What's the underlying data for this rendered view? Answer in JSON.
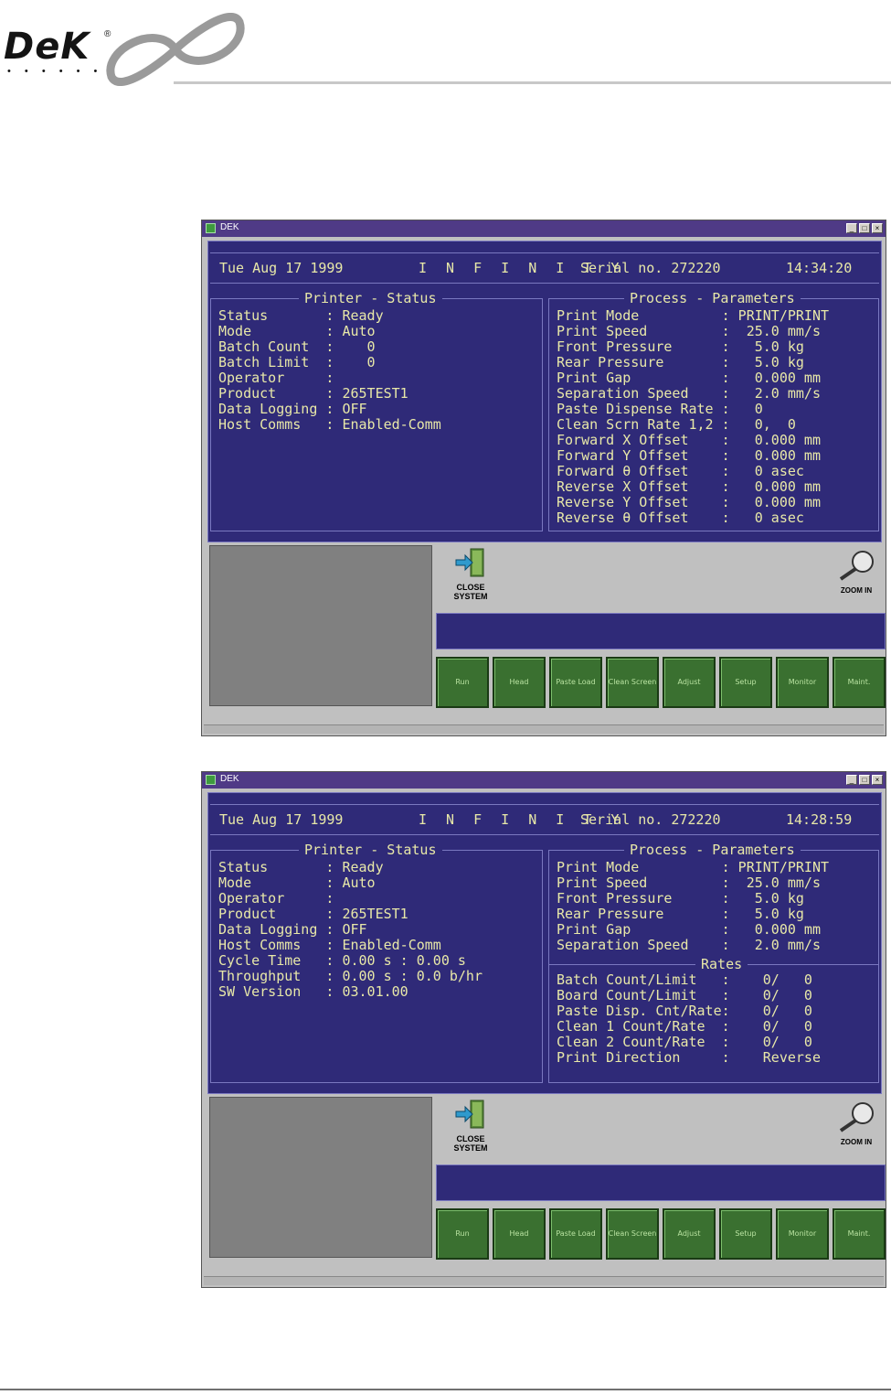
{
  "logo": {
    "word": "DeK",
    "reg": "®",
    "tagline": "• • • • • •"
  },
  "screens": [
    {
      "window_title": "DEK",
      "date": "Tue Aug 17 1999",
      "product_name": "I N F I N I T Y",
      "serial": "Serial no. 272220",
      "time": "14:34:20",
      "left_panel_title": "Printer - Status",
      "left_rows": [
        {
          "label": "Status       ",
          "value": ": Ready"
        },
        {
          "label": "Mode         ",
          "value": ": Auto"
        },
        {
          "label": "Batch Count  ",
          "value": ":    0"
        },
        {
          "label": "Batch Limit  ",
          "value": ":    0"
        },
        {
          "label": "Operator     ",
          "value": ":"
        },
        {
          "label": "Product      ",
          "value": ": 265TEST1"
        },
        {
          "label": "Data Logging ",
          "value": ": OFF"
        },
        {
          "label": "Host Comms   ",
          "value": ": Enabled-Comm"
        }
      ],
      "right_panel_title": "Process - Parameters",
      "right_rows": [
        {
          "label": "Print Mode          ",
          "value": ": PRINT/PRINT"
        },
        {
          "label": "Print Speed         ",
          "value": ":  25.0 mm/s"
        },
        {
          "label": "Front Pressure      ",
          "value": ":   5.0 kg"
        },
        {
          "label": "Rear Pressure       ",
          "value": ":   5.0 kg"
        },
        {
          "label": "Print Gap           ",
          "value": ":   0.000 mm"
        },
        {
          "label": "Separation Speed    ",
          "value": ":   2.0 mm/s"
        },
        {
          "label": "Paste Dispense Rate ",
          "value": ":   0"
        },
        {
          "label": "Clean Scrn Rate 1,2 ",
          "value": ":   0,  0"
        },
        {
          "label": "Forward X Offset    ",
          "value": ":   0.000 mm"
        },
        {
          "label": "Forward Y Offset    ",
          "value": ":   0.000 mm"
        },
        {
          "label": "Forward θ Offset    ",
          "value": ":   0 asec"
        },
        {
          "label": "Reverse X Offset    ",
          "value": ":   0.000 mm"
        },
        {
          "label": "Reverse Y Offset    ",
          "value": ":   0.000 mm"
        },
        {
          "label": "Reverse θ Offset    ",
          "value": ":   0 asec"
        }
      ],
      "close_label_1": "CLOSE",
      "close_label_2": "SYSTEM",
      "zoom_label": "ZOOM IN",
      "buttons": [
        "Run",
        "Head",
        "Paste Load",
        "Clean Screen",
        "Adjust",
        "Setup",
        "Monitor",
        "Maint."
      ]
    },
    {
      "window_title": "DEK",
      "date": "Tue Aug 17 1999",
      "product_name": "I N F I N I T Y",
      "serial": "Serial no. 272220",
      "time": "14:28:59",
      "left_panel_title": "Printer - Status",
      "left_rows": [
        {
          "label": "Status       ",
          "value": ": Ready"
        },
        {
          "label": "Mode         ",
          "value": ": Auto"
        },
        {
          "label": "Operator     ",
          "value": ":"
        },
        {
          "label": "Product      ",
          "value": ": 265TEST1"
        },
        {
          "label": "Data Logging ",
          "value": ": OFF"
        },
        {
          "label": "Host Comms   ",
          "value": ": Enabled-Comm"
        },
        {
          "label": "Cycle Time   ",
          "value": ": 0.00 s : 0.00 s"
        },
        {
          "label": "Throughput   ",
          "value": ": 0.00 s : 0.0 b/hr"
        },
        {
          "label": "SW Version   ",
          "value": ": 03.01.00"
        }
      ],
      "right_panel_title": "Process - Parameters",
      "right_rows": [
        {
          "label": "Print Mode          ",
          "value": ": PRINT/PRINT"
        },
        {
          "label": "Print Speed         ",
          "value": ":  25.0 mm/s"
        },
        {
          "label": "Front Pressure      ",
          "value": ":   5.0 kg"
        },
        {
          "label": "Rear Pressure       ",
          "value": ":   5.0 kg"
        },
        {
          "label": "Print Gap           ",
          "value": ":   0.000 mm"
        },
        {
          "label": "Separation Speed    ",
          "value": ":   2.0 mm/s"
        }
      ],
      "rates_title": "Rates",
      "rates_rows": [
        {
          "label": "Batch Count/Limit   ",
          "value": ":    0/   0"
        },
        {
          "label": "Board Count/Limit   ",
          "value": ":    0/   0"
        },
        {
          "label": "Paste Disp. Cnt/Rate",
          "value": ":    0/   0"
        },
        {
          "label": "Clean 1 Count/Rate  ",
          "value": ":    0/   0"
        },
        {
          "label": "Clean 2 Count/Rate  ",
          "value": ":    0/   0"
        },
        {
          "label": "Print Direction     ",
          "value": ":    Reverse"
        }
      ],
      "close_label_1": "CLOSE",
      "close_label_2": "SYSTEM",
      "zoom_label": "ZOOM IN",
      "buttons": [
        "Run",
        "Head",
        "Paste Load",
        "Clean Screen",
        "Adjust",
        "Setup",
        "Monitor",
        "Maint."
      ]
    }
  ],
  "colors": {
    "screen_bg": "#2f2a78",
    "text": "#e8e8a8",
    "button_green": "#3a7030",
    "title_bar": "#4f3a86"
  },
  "icons": {
    "close": "close-system-door-icon",
    "zoom": "magnifier-icon",
    "app": "dek-app-icon"
  }
}
